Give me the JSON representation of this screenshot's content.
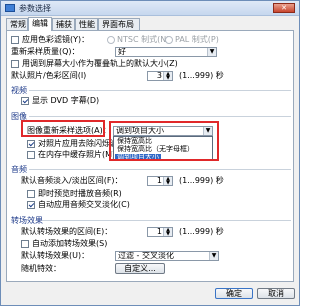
{
  "window": {
    "title": "参数选择",
    "close_label": "✕"
  },
  "tabs": [
    {
      "label": "常规"
    },
    {
      "label": "编辑"
    },
    {
      "label": "捕获"
    },
    {
      "label": "性能"
    },
    {
      "label": "界面布局"
    }
  ],
  "active_tab": "编辑",
  "options": {
    "color_filter_label": "应用色彩滤镜(Y)：",
    "ntsc_label": "NTSC 制式(N)",
    "pal_label": "PAL 制式(P)",
    "resample_quality_label": "重新采样质量(Q)：",
    "resample_quality_value": "好",
    "fit_screen_label": "用调到屏幕大小作为覆叠轨上的默认大小(Z)",
    "default_duration_label": "默认照片/色彩区间(I)",
    "default_duration_value": "3",
    "default_duration_range": "(1...999) 秒"
  },
  "video": {
    "section_label": "视频",
    "show_dvd_subtitle_label": "显示 DVD 字幕(D)"
  },
  "image": {
    "section_label": "图像",
    "resample_option_label": "图像重新采样选项(A)：",
    "resample_option_value": "调到项目大小",
    "dropdown_options": [
      "保持宽高比",
      "保持宽高比（无字母框）",
      "调到项目大小"
    ],
    "dropdown_selected_index": 2,
    "reduce_flicker_label": "对照片应用去除闪烁滤镜(T)",
    "cache_in_memory_label": "在内存中缓存照片(M)"
  },
  "audio": {
    "section_label": "音频",
    "fade_duration_label": "默认音频淡入/淡出区间(F)：",
    "fade_duration_value": "1",
    "fade_duration_range": "(1...999) 秒",
    "instant_preview_label": "即时预览时播放音频(R)",
    "auto_crossfade_label": "自动应用音频交叉淡化(C)"
  },
  "transition": {
    "section_label": "转场效果",
    "default_duration_label": "默认转场效果的区间(E)：",
    "default_duration_value": "1",
    "default_duration_range": "(1...999) 秒",
    "auto_add_label": "自动添加转场效果(S)",
    "default_effect_label": "默认转场效果(U)：",
    "default_effect_value": "过滤 - 交叉淡化",
    "random_effect_label": "随机特效：",
    "customize_label": "自定义..."
  },
  "footer": {
    "ok_label": "确定",
    "cancel_label": "取消"
  },
  "colors": {
    "section_blue": "#1d3a8a",
    "highlight_red": "#e0282a",
    "selection_blue": "#3169c6"
  }
}
